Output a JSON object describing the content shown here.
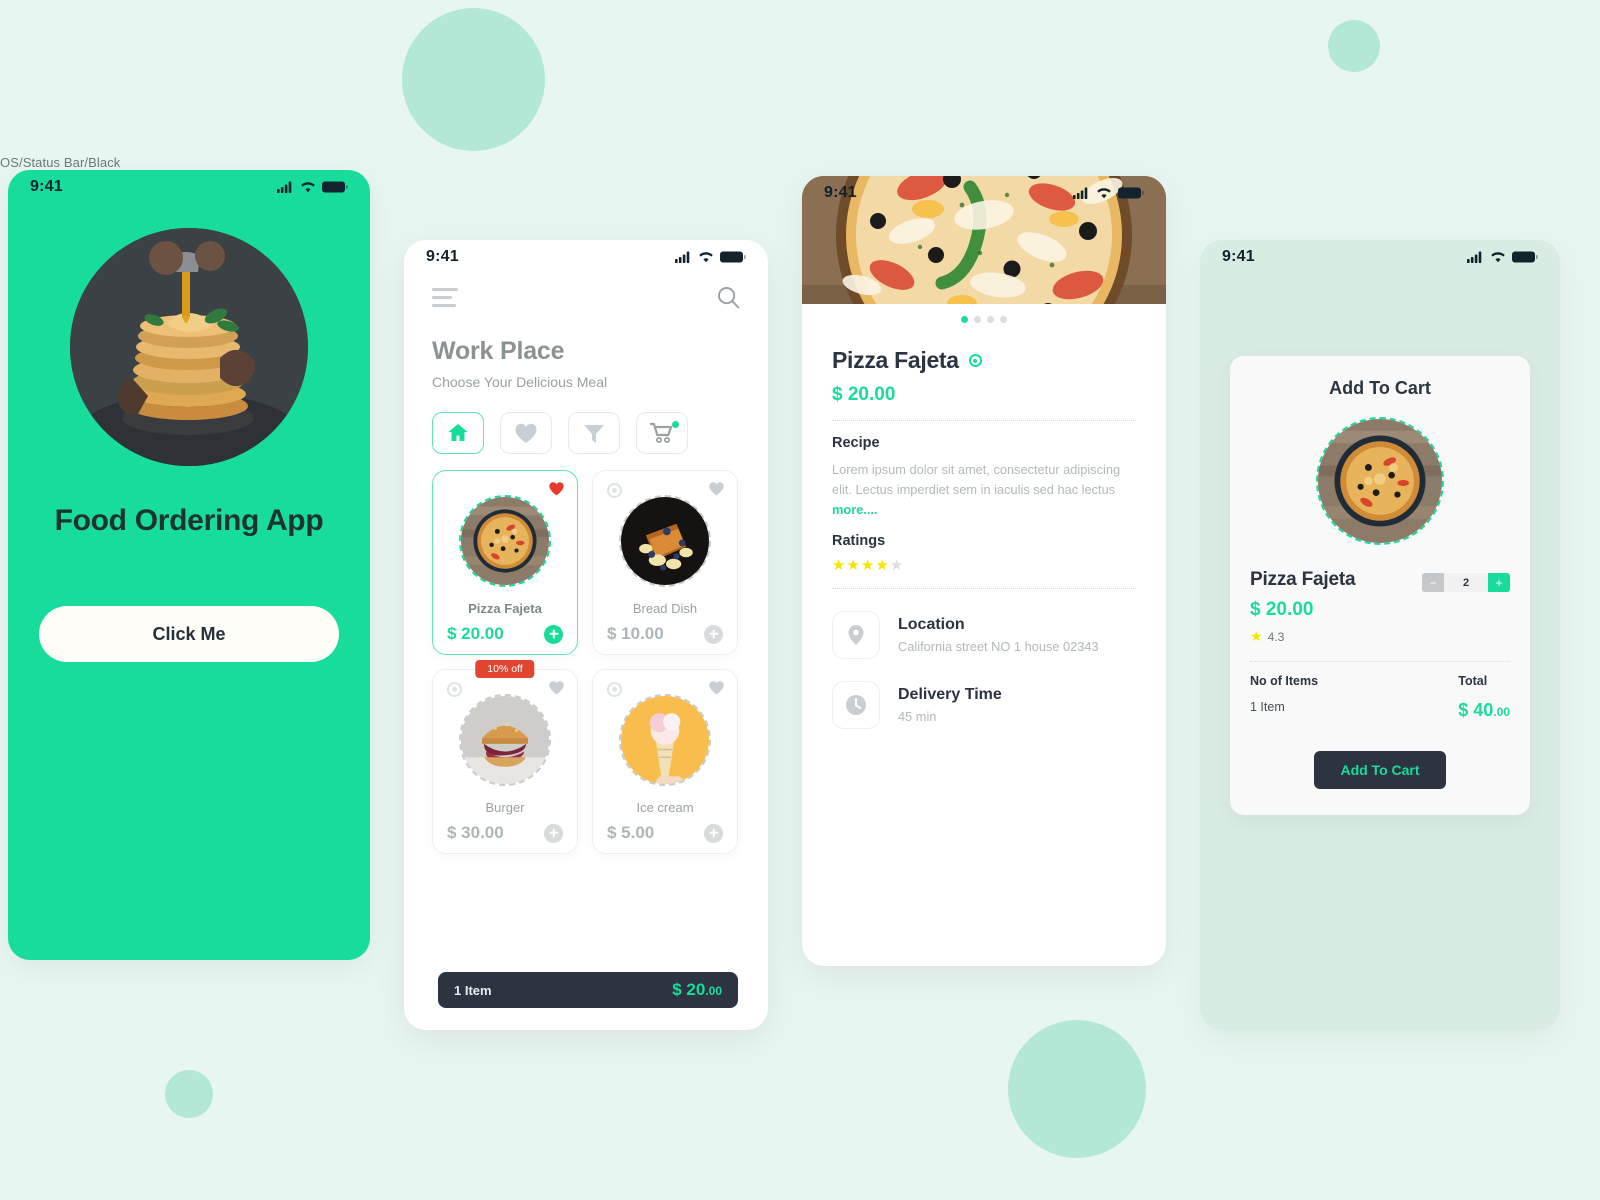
{
  "page": {
    "background": "#e8f6f1",
    "accent": "#17dc9b",
    "dark": "#2b3440"
  },
  "annotation": {
    "label": "OS/Status Bar/Black"
  },
  "splash": {
    "status": {
      "time": "9:41"
    },
    "title": "Food Ordering App",
    "cta": "Click Me"
  },
  "list": {
    "status": {
      "time": "9:41"
    },
    "heading": "Work Place",
    "subheading": "Choose Your Delicious Meal",
    "chips": [
      {
        "name": "home",
        "active": true
      },
      {
        "name": "favorites",
        "active": false
      },
      {
        "name": "filter",
        "active": false
      },
      {
        "name": "cart",
        "active": false,
        "badge": true
      }
    ],
    "products": [
      {
        "name": "Pizza Fajeta",
        "price": "$ 20.00",
        "selected": true,
        "favorite": true,
        "offer": ""
      },
      {
        "name": "Bread Dish",
        "price": "$ 10.00",
        "selected": false,
        "favorite": false,
        "offer": ""
      },
      {
        "name": "Burger",
        "price": "$ 30.00",
        "selected": false,
        "favorite": false,
        "offer": "10% off"
      },
      {
        "name": "Ice cream",
        "price": "$ 5.00",
        "selected": false,
        "favorite": false,
        "offer": ""
      }
    ],
    "cartbar": {
      "items": "1 Item",
      "total_major": "$ 20",
      "total_cents": ".00"
    }
  },
  "detail": {
    "status": {
      "time": "9:41"
    },
    "carousel": {
      "count": 4,
      "active_index": 0
    },
    "title": "Pizza Fajeta",
    "price": "$ 20.00",
    "recipe_label": "Recipe",
    "recipe_text": "Lorem ipsum dolor sit amet, consectetur adipiscing elit. Lectus imperdiet sem in iaculis sed hac lectus ",
    "recipe_more": "more....",
    "ratings_label": "Ratings",
    "ratings_filled": 4,
    "ratings_total": 5,
    "location": {
      "label": "Location",
      "value": "California street NO 1 house 02343",
      "icon": "map-pin-icon"
    },
    "delivery": {
      "label": "Delivery Time",
      "value": "45 min",
      "icon": "clock-icon"
    }
  },
  "cart": {
    "status": {
      "time": "9:41"
    },
    "modal_title": "Add To Cart",
    "product_name": "Pizza Fajeta",
    "product_price": "$ 20.00",
    "rating": "4.3",
    "quantity": "2",
    "minus_label": "−",
    "plus_label": "+",
    "items_header": "No of Items",
    "total_header": "Total",
    "items_value": "1 Item",
    "total_major": "$ 40",
    "total_cents": ".00",
    "button_label": "Add To Cart"
  }
}
